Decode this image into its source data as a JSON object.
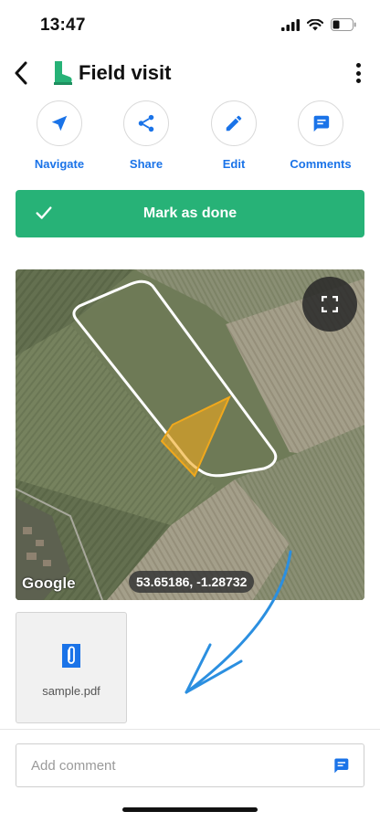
{
  "status_bar": {
    "time": "13:47",
    "icons": [
      "signal-icon",
      "wifi-icon",
      "battery-icon"
    ]
  },
  "header": {
    "title": "Field visit",
    "back_icon": "chevron-left-icon",
    "title_icon": "boot-icon",
    "menu_icon": "more-vertical-icon"
  },
  "actions": [
    {
      "label": "Navigate",
      "icon": "navigate-arrow-icon"
    },
    {
      "label": "Share",
      "icon": "share-icon"
    },
    {
      "label": "Edit",
      "icon": "pencil-icon"
    },
    {
      "label": "Comments",
      "icon": "comment-icon"
    }
  ],
  "mark_done": {
    "label": "Mark as done",
    "icon": "check-icon",
    "color": "#27b277"
  },
  "map": {
    "attribution": "Google",
    "coordinates": "53.65186, -1.28732",
    "fullscreen_icon": "fullscreen-icon",
    "field_outline_color": "#ffffff",
    "zone_color": "#f0a81c"
  },
  "attachment": {
    "filename": "sample.pdf",
    "icon": "paperclip-file-icon"
  },
  "comment": {
    "placeholder": "Add comment",
    "value": "",
    "send_icon": "comment-send-icon"
  },
  "colors": {
    "accent": "#1a73e8",
    "success": "#27b277",
    "title_icon": "#27b277"
  }
}
